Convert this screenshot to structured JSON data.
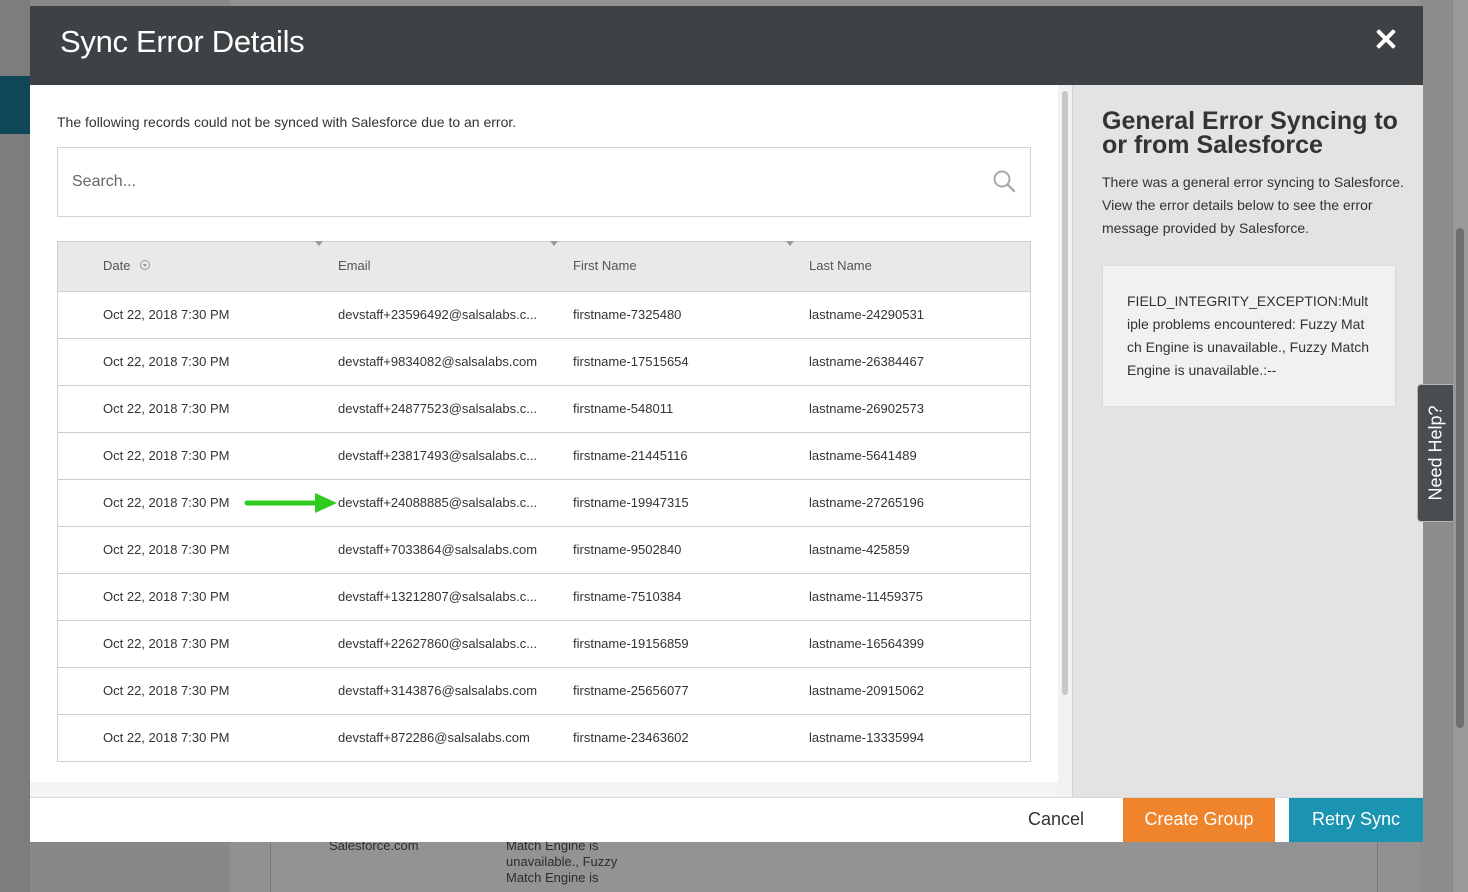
{
  "modal": {
    "title": "Sync Error Details",
    "intro": "The following records could not be synced with Salesforce due to an error.",
    "search_placeholder": "Search...",
    "icons": {
      "close": "close-icon",
      "search": "search-icon",
      "sort": "sort-icon"
    }
  },
  "table": {
    "headers": {
      "date": "Date",
      "email": "Email",
      "first_name": "First Name",
      "last_name": "Last Name"
    },
    "rows": [
      {
        "date": "Oct 22, 2018 7:30 PM",
        "email": "devstaff+23596492@salsalabs.c...",
        "first_name": "firstname-7325480",
        "last_name": "lastname-24290531"
      },
      {
        "date": "Oct 22, 2018 7:30 PM",
        "email": "devstaff+9834082@salsalabs.com",
        "first_name": "firstname-17515654",
        "last_name": "lastname-26384467"
      },
      {
        "date": "Oct 22, 2018 7:30 PM",
        "email": "devstaff+24877523@salsalabs.c...",
        "first_name": "firstname-548011",
        "last_name": "lastname-26902573"
      },
      {
        "date": "Oct 22, 2018 7:30 PM",
        "email": "devstaff+23817493@salsalabs.c...",
        "first_name": "firstname-21445116",
        "last_name": "lastname-5641489"
      },
      {
        "date": "Oct 22, 2018 7:30 PM",
        "email": "devstaff+24088885@salsalabs.c...",
        "first_name": "firstname-19947315",
        "last_name": "lastname-27265196"
      },
      {
        "date": "Oct 22, 2018 7:30 PM",
        "email": "devstaff+7033864@salsalabs.com",
        "first_name": "firstname-9502840",
        "last_name": "lastname-425859"
      },
      {
        "date": "Oct 22, 2018 7:30 PM",
        "email": "devstaff+13212807@salsalabs.c...",
        "first_name": "firstname-7510384",
        "last_name": "lastname-11459375"
      },
      {
        "date": "Oct 22, 2018 7:30 PM",
        "email": "devstaff+22627860@salsalabs.c...",
        "first_name": "firstname-19156859",
        "last_name": "lastname-16564399"
      },
      {
        "date": "Oct 22, 2018 7:30 PM",
        "email": "devstaff+3143876@salsalabs.com",
        "first_name": "firstname-25656077",
        "last_name": "lastname-20915062"
      },
      {
        "date": "Oct 22, 2018 7:30 PM",
        "email": "devstaff+872286@salsalabs.com",
        "first_name": "firstname-23463602",
        "last_name": "lastname-13335994"
      }
    ],
    "highlight_arrow_color": "#2ecc1f"
  },
  "error_panel": {
    "title": "General Error Syncing to or from Salesforce",
    "description": "There was a general error syncing to Salesforce. View the error details below to see the error message provided by Salesforce.",
    "message": "FIELD_INTEGRITY_EXCEPTION:Multiple problems encountered: Fuzzy Match Engine is unavailable., Fuzzy Match Engine is unavailable.:--"
  },
  "footer": {
    "cancel_label": "Cancel",
    "create_group_label": "Create Group",
    "retry_sync_label": "Retry Sync",
    "colors": {
      "create_group": "#f0842c",
      "retry_sync": "#1a94b0"
    }
  },
  "need_help": {
    "label": "Need Help?"
  },
  "background": {
    "text_1": "Salesforce.com",
    "text_2": "Match Engine is",
    "text_3": "unavailable., Fuzzy",
    "text_4": "Match Engine is"
  }
}
